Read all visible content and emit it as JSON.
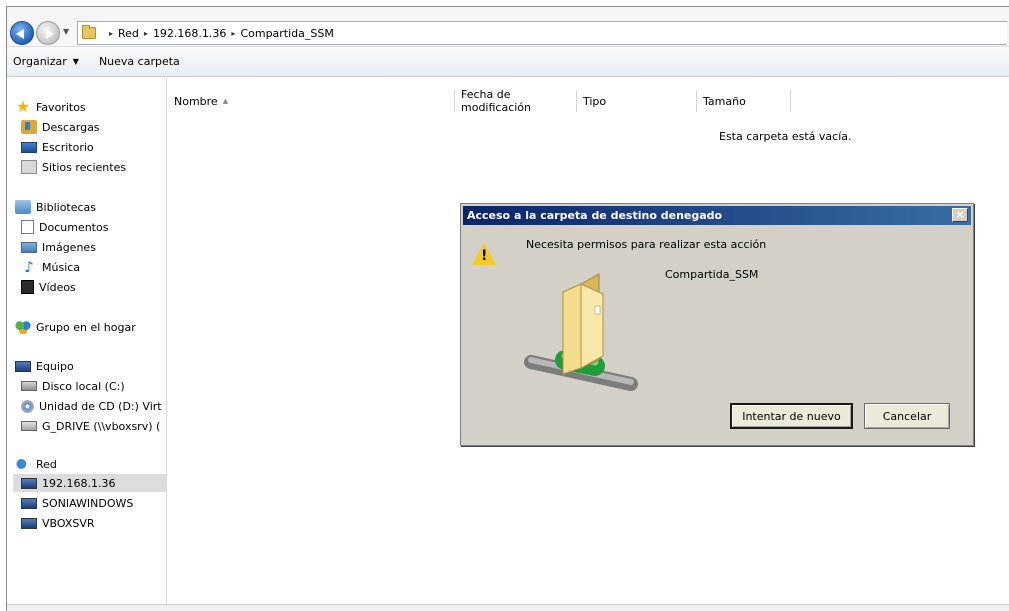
{
  "address_bar": {
    "breadcrumbs": [
      "Red",
      "192.168.1.36",
      "Compartida_SSM"
    ]
  },
  "toolbar": {
    "organize_label": "Organizar",
    "new_folder_label": "Nueva carpeta"
  },
  "nav_pane": {
    "favorites": {
      "label": "Favoritos",
      "items": [
        "Descargas",
        "Escritorio",
        "Sitios recientes"
      ]
    },
    "libraries": {
      "label": "Bibliotecas",
      "items": [
        "Documentos",
        "Imágenes",
        "Música",
        "Vídeos"
      ]
    },
    "homegroup": {
      "label": "Grupo en el hogar"
    },
    "computer": {
      "label": "Equipo",
      "items": [
        "Disco local (C:)",
        "Unidad de CD (D:) Virt",
        "G_DRIVE (\\\\vboxsrv) ("
      ]
    },
    "network": {
      "label": "Red",
      "items": [
        "192.168.1.36",
        "SONIAWINDOWS",
        "VBOXSVR"
      ],
      "selected_index": 0
    }
  },
  "file_list": {
    "columns": [
      "Nombre",
      "Fecha de modificación",
      "Tipo",
      "Tamaño"
    ],
    "empty_message": "Esta carpeta está vacía."
  },
  "dialog": {
    "title": "Acceso a la carpeta de destino denegado",
    "close_glyph": "×",
    "message": "Necesita permisos para realizar esta acción",
    "folder_name": "Compartida_SSM",
    "retry_label": "Intentar de nuevo",
    "cancel_label": "Cancelar",
    "warning_mark": "!"
  }
}
